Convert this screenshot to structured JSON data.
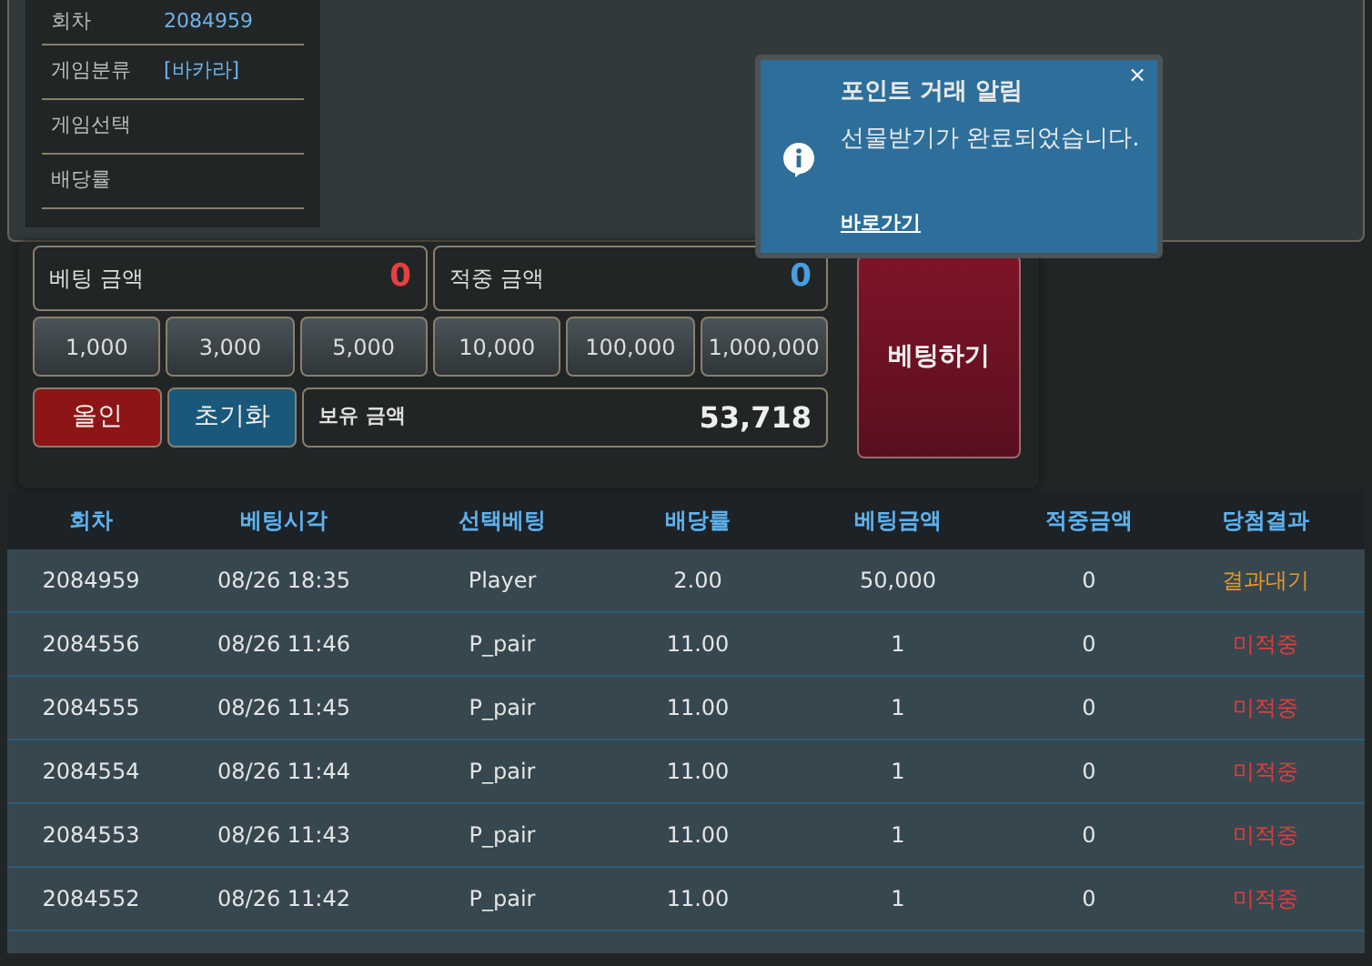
{
  "info_panel": {
    "rows": [
      {
        "label": "회차",
        "value": "2084959"
      },
      {
        "label": "게임분류",
        "value": "[바카라]"
      },
      {
        "label": "게임선택"
      },
      {
        "label": "배당률"
      }
    ]
  },
  "bet_panel": {
    "bet_amount": {
      "label": "베팅 금액",
      "value": "0"
    },
    "win_amount": {
      "label": "적중 금액",
      "value": "0"
    },
    "chips": [
      "1,000",
      "3,000",
      "5,000",
      "10,000",
      "100,000",
      "1,000,000"
    ],
    "all_in_button": "올인",
    "reset_button": "초기화",
    "balance": {
      "label": "보유 금액",
      "value": "53,718"
    },
    "bet_button": "베팅하기"
  },
  "table": {
    "columns": [
      "회차",
      "베팅시각",
      "선택베팅",
      "배당률",
      "베팅금액",
      "적중금액",
      "당첨결과"
    ],
    "rows": [
      {
        "cells": [
          "2084959",
          "08/26 18:35",
          "Player",
          "2.00",
          "50,000",
          "0",
          "결과대기"
        ],
        "color": "#e8962c"
      },
      {
        "cells": [
          "2084556",
          "08/26 11:46",
          "P_pair",
          "11.00",
          "1",
          "0",
          "미적중"
        ],
        "color": "#e43c3c"
      },
      {
        "cells": [
          "2084555",
          "08/26 11:45",
          "P_pair",
          "11.00",
          "1",
          "0",
          "미적중"
        ],
        "color": "#e43c3c"
      },
      {
        "cells": [
          "2084554",
          "08/26 11:44",
          "P_pair",
          "11.00",
          "1",
          "0",
          "미적중"
        ],
        "color": "#e43c3c"
      },
      {
        "cells": [
          "2084553",
          "08/26 11:43",
          "P_pair",
          "11.00",
          "1",
          "0",
          "미적중"
        ],
        "color": "#e43c3c"
      },
      {
        "cells": [
          "2084552",
          "08/26 11:42",
          "P_pair",
          "11.00",
          "1",
          "0",
          "미적중"
        ],
        "color": "#e43c3c"
      }
    ]
  },
  "toast": {
    "title": "포인트 거래 알림",
    "message": "선물받기가 완료되었습니다.",
    "link": "바로가기",
    "close": "×"
  }
}
